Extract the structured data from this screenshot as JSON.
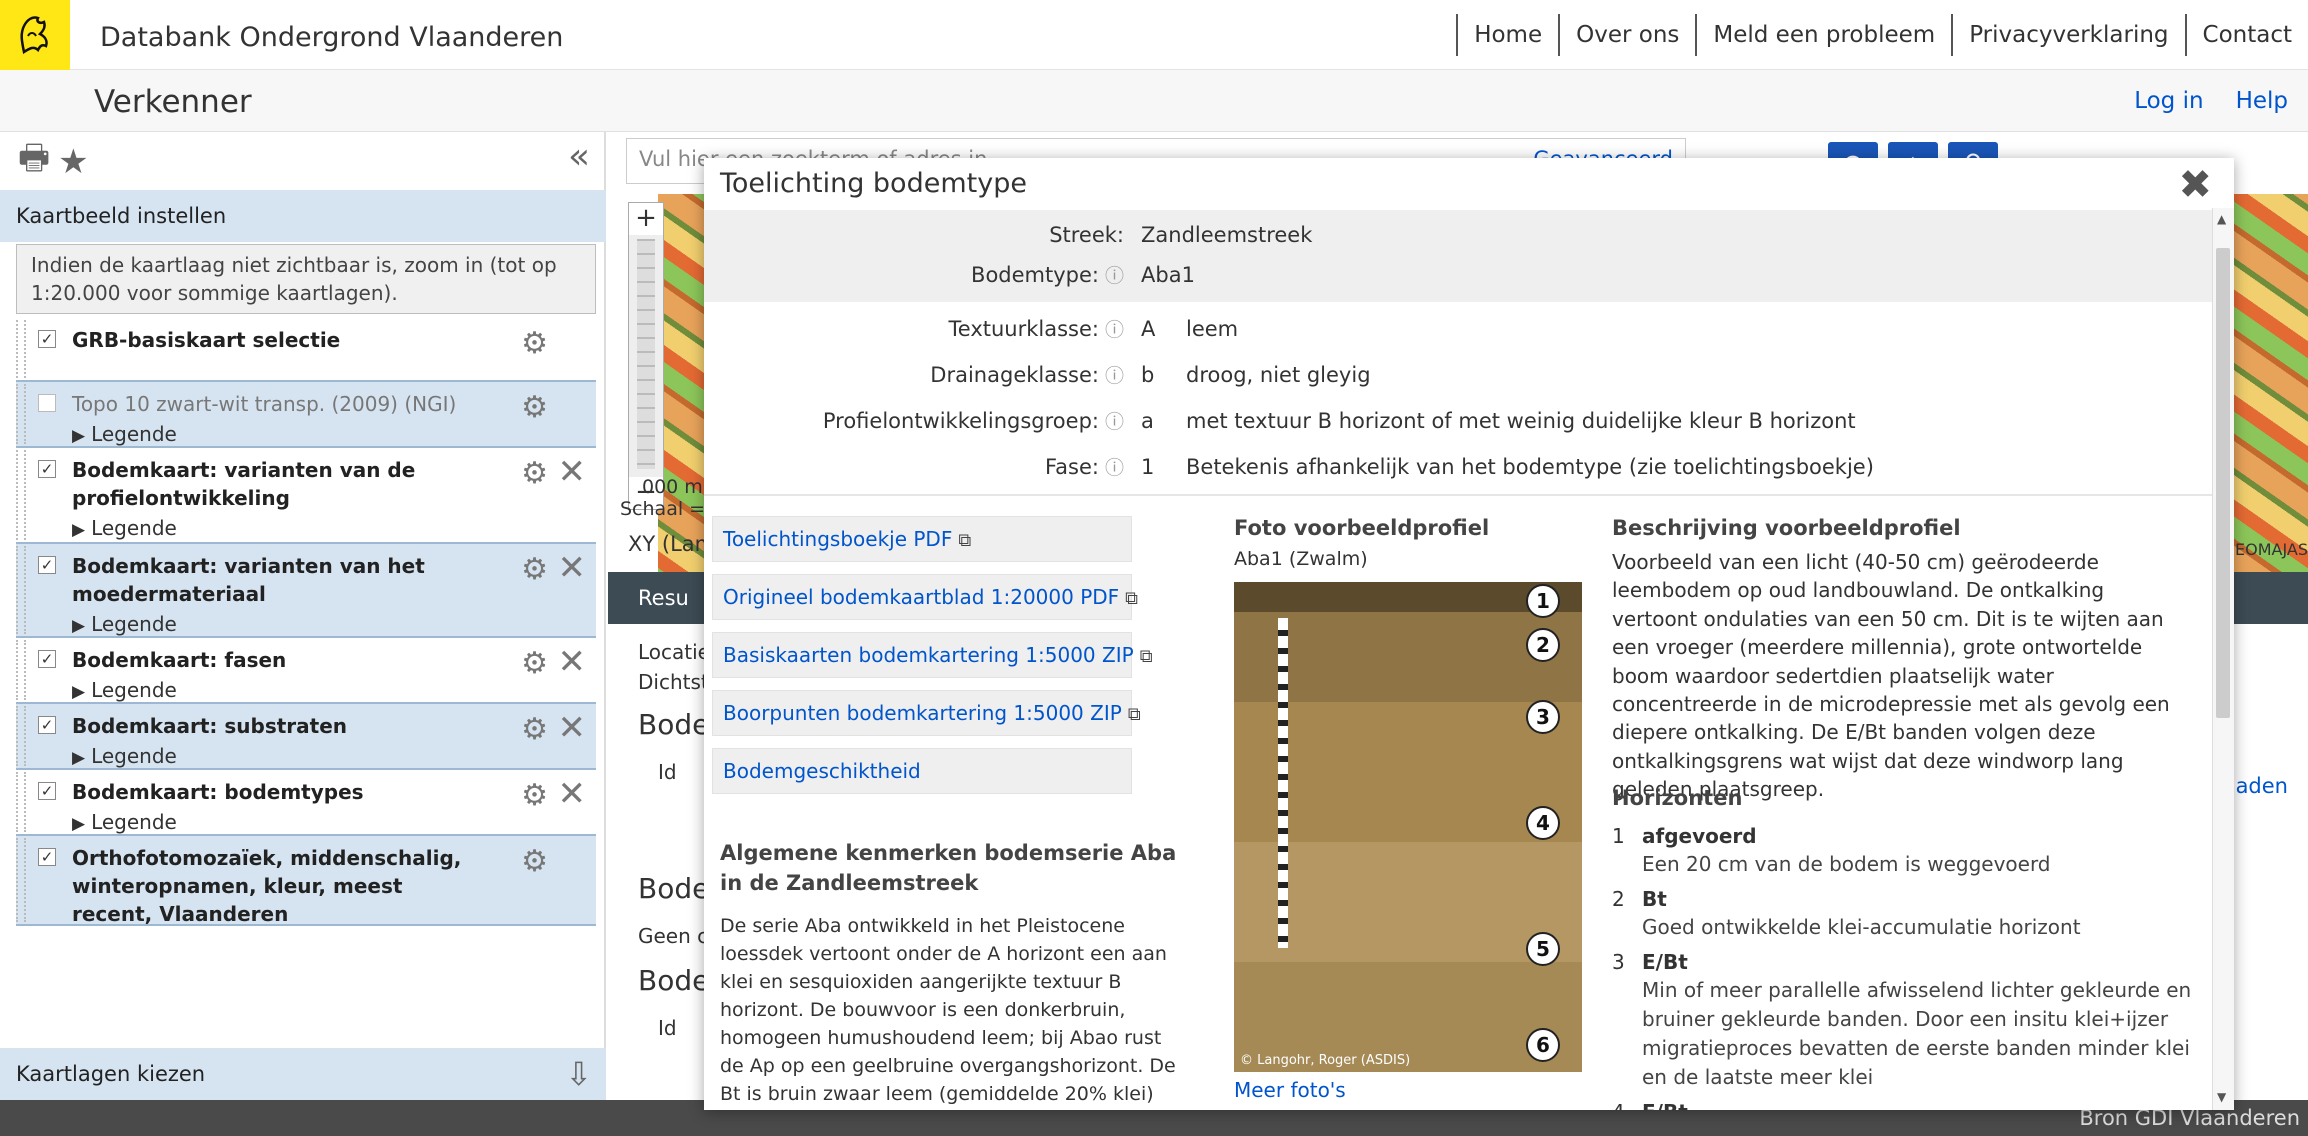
{
  "header": {
    "site_title": "Databank Ondergrond Vlaanderen",
    "nav": [
      "Home",
      "Over ons",
      "Meld een probleem",
      "Privacyverklaring",
      "Contact"
    ]
  },
  "subheader": {
    "title": "Verkenner",
    "login": "Log in",
    "help": "Help"
  },
  "sidebar": {
    "panel_title": "Kaartbeeld instellen",
    "notice": "Indien de kaartlaag niet zichtbaar is, zoom in (tot op 1:20.000 voor sommige kaartlagen).",
    "legend_label": "Legende",
    "layers": [
      {
        "name": "GRB-basiskaart selectie",
        "checked": true
      },
      {
        "name": "Topo 10 zwart-wit transp. (2009) (NGI)",
        "checked": false
      },
      {
        "name": "Bodemkaart: varianten van de profielontwikkeling",
        "checked": true
      },
      {
        "name": "Bodemkaart: varianten van het moedermateriaal",
        "checked": true
      },
      {
        "name": "Bodemkaart: fasen",
        "checked": true
      },
      {
        "name": "Bodemkaart: substraten",
        "checked": true
      },
      {
        "name": "Bodemkaart: bodemtypes",
        "checked": true
      },
      {
        "name": "Orthofotomozaïek, middenschalig, winteropnamen, kleur, meest recent, Vlaanderen",
        "checked": true
      }
    ],
    "choose_layers": "Kaartlagen kiezen"
  },
  "map": {
    "search_placeholder": "Vul hier een zoekterm of adres in",
    "search_advanced": "Geavanceerd",
    "scale_label": "Schaal =",
    "scale_partial": "000 m",
    "xy_label": "XY (Lam",
    "results_tab": "Resu",
    "credit": "GEOMAJAS",
    "results": {
      "locatie": "Locatie",
      "dichtst": "Dichtst",
      "bode1": "Bode",
      "id1": "Id",
      "bode2": "Bode",
      "geen": "Geen c",
      "bode3": "Bode",
      "id2": "Id",
      "right_link": "aden"
    }
  },
  "modal": {
    "title": "Toelichting bodemtype",
    "rows": [
      {
        "key": "Streek:",
        "code": "",
        "value": "Zandleemstreek",
        "info": false
      },
      {
        "key": "Bodemtype:",
        "code": "",
        "value": "Aba1",
        "info": true
      },
      {
        "key": "Textuurklasse:",
        "code": "A",
        "value": "leem",
        "info": true
      },
      {
        "key": "Drainageklasse:",
        "code": "b",
        "value": "droog, niet gleyig",
        "info": true
      },
      {
        "key": "Profielontwikkelingsgroep:",
        "code": "a",
        "value": "met textuur B horizont of met weinig duidelijke kleur B horizont",
        "info": true
      },
      {
        "key": "Fase:",
        "code": "1",
        "value": "Betekenis afhankelijk van het bodemtype (zie toelichtingsboekje)",
        "info": true
      }
    ],
    "links": [
      "Toelichtingsboekje PDF",
      "Origineel bodemkaartblad 1:20000 PDF",
      "Basiskaarten bodemkartering 1:5000 ZIP",
      "Boorpunten bodemkartering 1:5000 ZIP",
      "Bodemgeschiktheid"
    ],
    "general_title": "Algemene kenmerken bodemserie Aba in de Zandleemstreek",
    "general_text": "De serie Aba ontwikkeld in het Pleistocene loessdek vertoont onder de A horizont een aan klei en sesquioxiden aangerijkte textuur B horizont. De bouwvoor is een donkerbruin, homogeen humushoudend leem; bij Abao rust de Ap op een geelbruine overgangshorizont. De Bt is bruin zwaar leem (gemiddelde 20% klei)",
    "photo_title": "Foto voorbeeldprofiel",
    "photo_sub": "Aba1 (Zwalm)",
    "photo_credit": "© Langohr, Roger (ASDIS)",
    "photo_numbers": [
      "1",
      "2",
      "3",
      "4",
      "5",
      "6"
    ],
    "more_photos": "Meer foto's",
    "desc_title": "Beschrijving voorbeeldprofiel",
    "desc_text": "Voorbeeld van een licht (40-50 cm) geërodeerde leembodem op oud landbouwland. De ontkalking vertoont ondulaties van een 50 cm. Dit is te wijten aan een vroeger (meerdere millennia), grote ontwortelde boom waardoor sedertdien plaatselijk water concentreerde in de microdepressie met als gevolg een diepere ontkalking. De E/Bt banden volgen deze ontkalkingsgrens wat wijst dat deze windworp lang geleden plaatsgreep.",
    "horizons_title": "Horizonten",
    "horizons": [
      {
        "n": "1",
        "name": "afgevoerd",
        "desc": "Een 20 cm van de bodem is weggevoerd"
      },
      {
        "n": "2",
        "name": "Bt",
        "desc": "Goed ontwikkelde klei-accumulatie horizont"
      },
      {
        "n": "3",
        "name": "E/Bt",
        "desc": "Min of meer parallelle afwisselend lichter gekleurde en bruiner gekleurde banden. Door een insitu klei+ijzer migratieproces bevatten de eerste banden minder klei en de laatste meer klei"
      },
      {
        "n": "4",
        "name": "E/Bt",
        "desc": ""
      }
    ]
  },
  "footer": {
    "source": "Bron GDI Vlaanderen"
  },
  "colors": {
    "brand_yellow": "#ffe615",
    "link_blue": "#0055cc",
    "panel_blue": "#d6e4f1",
    "dark_bar": "#3d4b55"
  }
}
